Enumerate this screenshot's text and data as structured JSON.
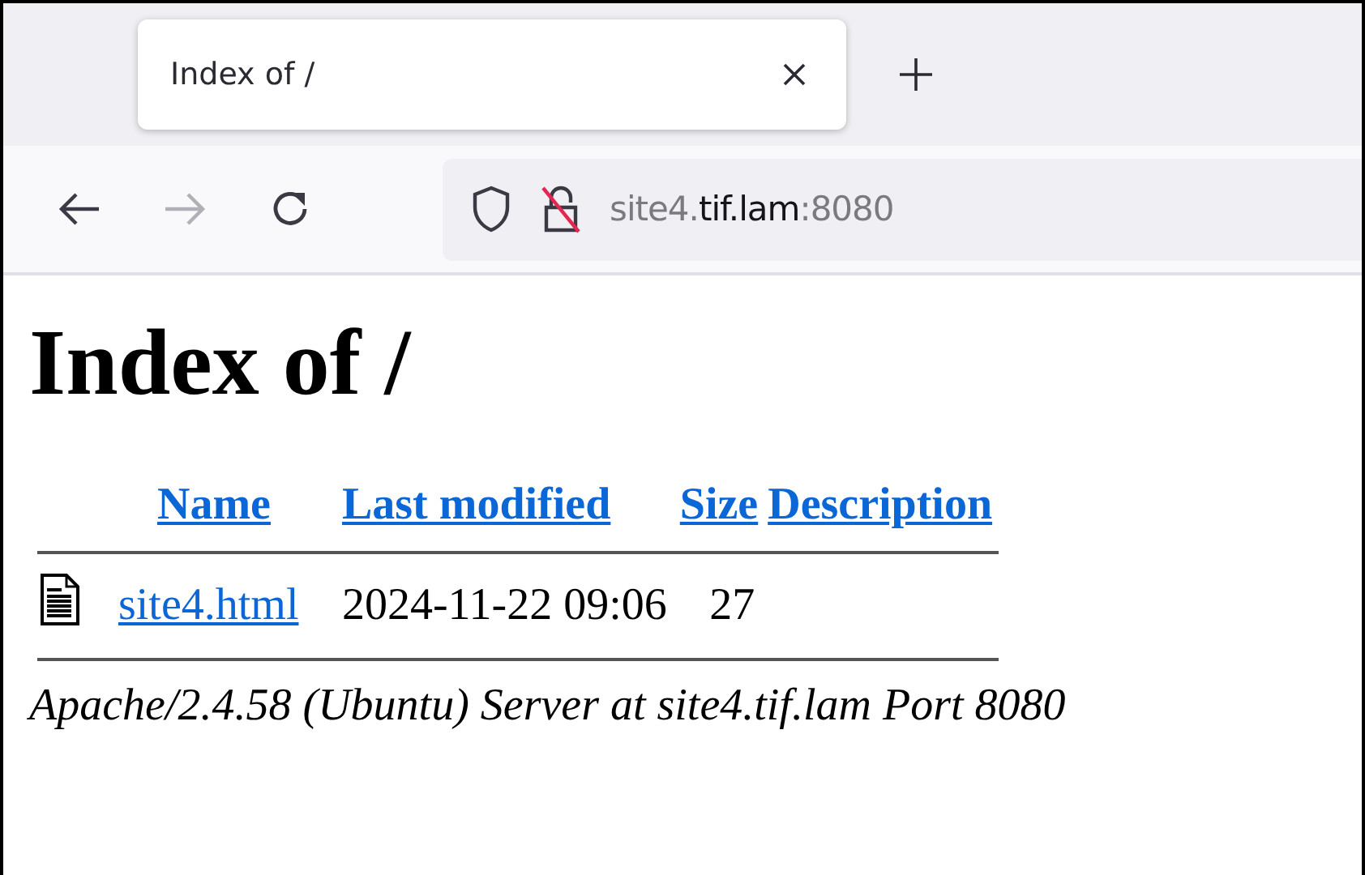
{
  "browser": {
    "tab": {
      "title": "Index of /",
      "selected": true
    },
    "address": {
      "prefix": "site4.",
      "domain": "tif.lam",
      "suffix": ":8080"
    }
  },
  "page": {
    "heading": "Index of /",
    "columns": [
      "Name",
      "Last modified",
      "Size",
      "Description"
    ],
    "rows": [
      {
        "name": "site4.html",
        "last_modified": "2024-11-22 09:06",
        "size": "27"
      }
    ],
    "footer": "Apache/2.4.58 (Ubuntu) Server at site4.tif.lam Port 8080"
  }
}
